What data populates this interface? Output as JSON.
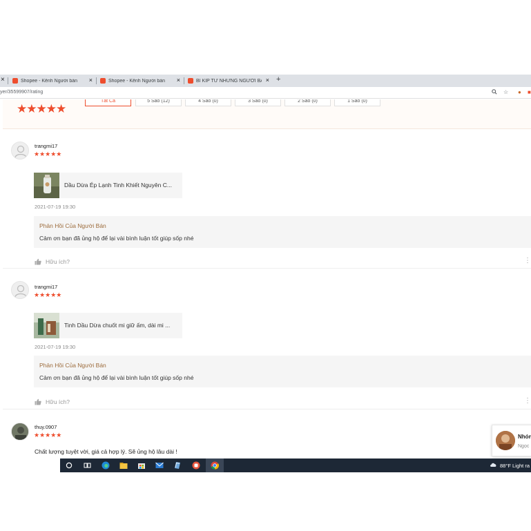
{
  "browser": {
    "tabs": [
      {
        "title": "Shopee - Kênh Người bán",
        "close": "×"
      },
      {
        "title": "Shopee - Kênh Người bán",
        "close": "×"
      },
      {
        "title": "BÍ KÍP TỪ NHỮNG NGƯỜI BÁN C",
        "close": "×"
      }
    ],
    "new_tab": "+",
    "first_close": "×",
    "url": "yer/35599907/rating"
  },
  "filter": {
    "overall_stars": "★★★★★",
    "buttons": [
      "Tất Cả",
      "5 Sao (12)",
      "4 Sao (0)",
      "3 Sao (0)",
      "2 Sao (0)",
      "1 Sao (0)"
    ]
  },
  "reviews": [
    {
      "username": "trangmi17",
      "stars": "★★★★★",
      "product": "Dầu Dừa Ép Lạnh Tinh Khiết Nguyên C...",
      "date": "2021-07-19 19:30",
      "reply_title": "Phản Hồi Của Người Bán",
      "reply_text": "Cảm ơn bạn đã ủng hộ để lại vài bình luận tốt giúp sốp nhé",
      "helpful": "Hữu ích?"
    },
    {
      "username": "trangmi17",
      "stars": "★★★★★",
      "product": "Tinh Dầu Dừa chuốt mi giữ ấm, dài mi ...",
      "date": "2021-07-19 19:30",
      "reply_title": "Phản Hồi Của Người Bán",
      "reply_text": "Cảm ơn bạn đã ủng hộ để lại vài bình luận tốt giúp sốp nhé",
      "helpful": "Hữu ích?"
    },
    {
      "username": "thuy.0907",
      "stars": "★★★★★",
      "comment": "Chất lượng tuyệt vời, giá cả hợp lý. Sẽ ủng hộ lâu dài !"
    }
  ],
  "chat": {
    "name": "Nhón",
    "sub": "Ngọc"
  },
  "taskbar": {
    "weather": "88°F  Light ra"
  },
  "colors": {
    "accent": "#ee4d2d",
    "reply_title": "#9c6b3b",
    "taskbar": "#1d2836"
  },
  "icons": [
    "user-avatar-icon",
    "thumbs-up-icon",
    "kebab-icon",
    "search-icon",
    "star-icon",
    "windows-search-icon",
    "task-view-icon",
    "edge-icon",
    "file-explorer-icon",
    "store-icon",
    "mail-icon",
    "chrome-icon",
    "cloud-rain-icon"
  ]
}
